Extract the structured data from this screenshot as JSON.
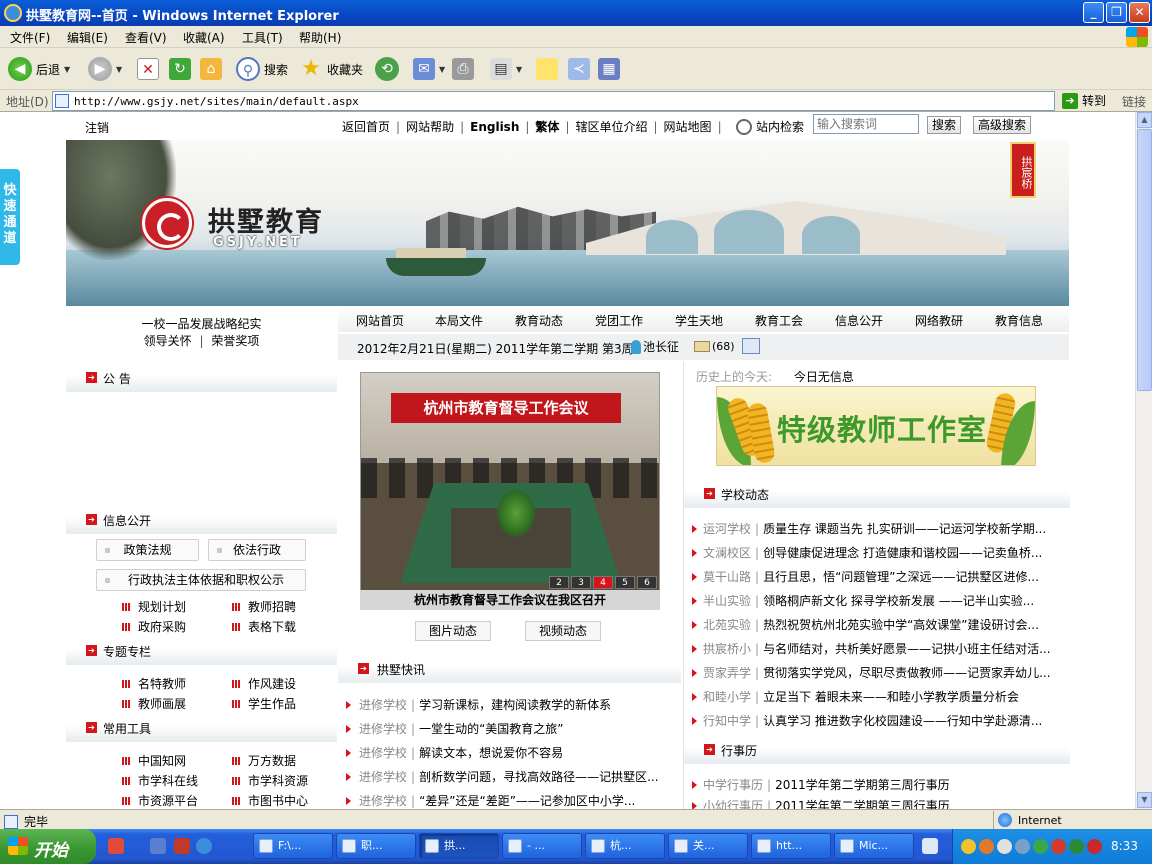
{
  "window": {
    "title": "拱墅教育网--首页 - Windows Internet Explorer",
    "minimize": "_",
    "maximize": "❐",
    "close": "✕"
  },
  "menu": [
    "文件(F)",
    "编辑(E)",
    "查看(V)",
    "收藏(A)",
    "工具(T)",
    "帮助(H)"
  ],
  "toolbar": {
    "back": "后退",
    "search": "搜索",
    "favorites": "收藏夹"
  },
  "address": {
    "label": "地址(D)",
    "url": "http://www.gsjy.net/sites/main/default.aspx",
    "go": "转到",
    "links": "链接"
  },
  "quick_channel": "快速通道",
  "top_links": {
    "logout": "注销",
    "nav": [
      "返回首页",
      "网站帮助",
      "English",
      "繁体",
      "辖区单位介绍",
      "网站地图"
    ],
    "site_search": "站内检索",
    "search_placeholder": "输入搜索词",
    "search_btn": "搜索",
    "advanced_btn": "高级搜索"
  },
  "banner": {
    "name": "拱墅教育",
    "name_en": "GSJY.NET",
    "seal": "拱宸桥"
  },
  "left": {
    "strategy": "一校一品发展战略纪实",
    "care": "领导关怀",
    "honor": "荣誉奖项",
    "notice_title": "公 告",
    "info_title": "信息公开",
    "policy": "政策法规",
    "lawful": "依法行政",
    "admin_basis": "行政执法主体依据和职权公示",
    "info_links": [
      "规划计划",
      "教师招聘",
      "政府采购",
      "表格下载"
    ],
    "topic_title": "专题专栏",
    "topic_links": [
      "名特教师",
      "作风建设",
      "教师画展",
      "学生作品"
    ],
    "tools_title": "常用工具",
    "tool_links": [
      "中国知网",
      "万方数据",
      "市学科在线",
      "市学科资源",
      "市资源平台",
      "市图书中心"
    ]
  },
  "nav": [
    "网站首页",
    "本局文件",
    "教育动态",
    "党团工作",
    "学生天地",
    "教育工会",
    "信息公开",
    "网络教研",
    "教育信息"
  ],
  "datebar": {
    "date": "2012年2月21日(星期二) 2011学年第二学期 第3周",
    "leader": "池长征",
    "mail_count": "(68)"
  },
  "middle": {
    "photo_banner": "杭州市教育督导工作会议",
    "photo_pages": [
      "2",
      "3",
      "4",
      "5",
      "6"
    ],
    "caption": "杭州市教育督导工作会议在我区召开",
    "photo_btn": "图片动态",
    "video_btn": "视频动态",
    "news_title": "拱墅快讯",
    "news": [
      {
        "src": "进修学校",
        "t": "学习新课标，建构阅读教学的新体系"
      },
      {
        "src": "进修学校",
        "t": "一堂生动的“美国教育之旅”"
      },
      {
        "src": "进修学校",
        "t": "解读文本，想说爱你不容易"
      },
      {
        "src": "进修学校",
        "t": "剖析数学问题，寻找高效路径——记拱墅区..."
      },
      {
        "src": "进修学校",
        "t": "“差异”还是“差距”——记参加区中小学..."
      }
    ]
  },
  "right": {
    "history_label": "历史上的今天:",
    "history_value": "今日无信息",
    "ad_text": "特级教师工作室",
    "school_title": "学校动态",
    "school_news": [
      {
        "src": "运河学校",
        "t": "质量生存 课题当先 扎实研训——记运河学校新学期..."
      },
      {
        "src": "文澜校区",
        "t": "创导健康促进理念 打造健康和谐校园——记卖鱼桥..."
      },
      {
        "src": "莫干山路",
        "t": "且行且思，悟“问题管理”之深远——记拱墅区进修..."
      },
      {
        "src": "半山实验",
        "t": "领略桐庐新文化 探寻学校新发展 ——记半山实验..."
      },
      {
        "src": "北苑实验",
        "t": "热烈祝贺杭州北苑实验中学“高效课堂”建设研讨会..."
      },
      {
        "src": "拱宸桥小",
        "t": "与名师结对，共析美好愿景——记拱小班主任结对活..."
      },
      {
        "src": "贾家弄学",
        "t": "贯彻落实学党风，尽职尽责做教师——记贾家弄幼儿..."
      },
      {
        "src": "和睦小学",
        "t": "立足当下 着眼未来——和睦小学教学质量分析会"
      },
      {
        "src": "行知中学",
        "t": "认真学习 推进数字化校园建设——行知中学赴源清..."
      }
    ],
    "calendar_title": "行事历",
    "calendar": [
      {
        "src": "中学行事历",
        "t": "2011学年第二学期第三周行事历"
      },
      {
        "src": "小幼行事历",
        "t": "2011学年第二学期第三周行事历"
      }
    ]
  },
  "status": {
    "done": "完毕",
    "zone": "Internet"
  },
  "taskbar": {
    "start": "开始",
    "tasks": [
      "F:\\...",
      "职...",
      "拱...",
      "- ...",
      "杭...",
      "关...",
      "htt...",
      "Mic..."
    ],
    "clock": "8:33"
  }
}
